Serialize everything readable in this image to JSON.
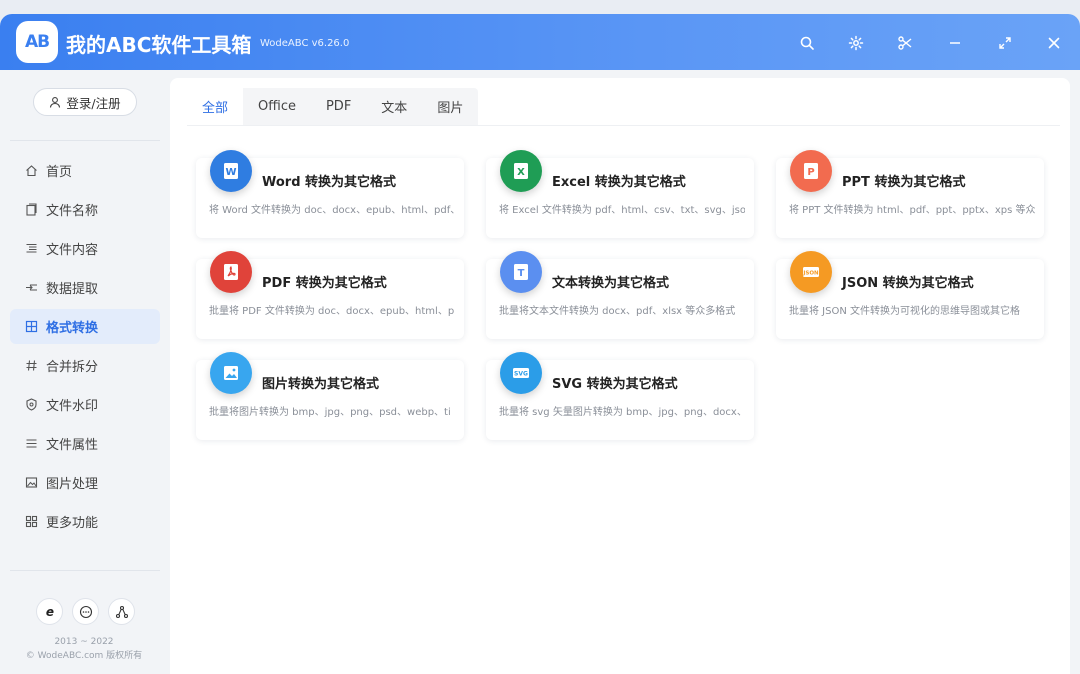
{
  "app": {
    "title": "我的ABC软件工具箱",
    "version": "WodeABC v6.26.0",
    "logo_text": "AB"
  },
  "titlebar_buttons": [
    "search-icon",
    "gear-icon",
    "scissors-icon",
    "minimize-icon",
    "maximize-icon",
    "close-icon"
  ],
  "sidebar": {
    "login_label": "登录/注册",
    "items": [
      {
        "label": "首页",
        "icon": "home-icon"
      },
      {
        "label": "文件名称",
        "icon": "file-name-icon"
      },
      {
        "label": "文件内容",
        "icon": "file-content-icon"
      },
      {
        "label": "数据提取",
        "icon": "data-extract-icon"
      },
      {
        "label": "格式转换",
        "icon": "format-convert-icon",
        "active": true
      },
      {
        "label": "合并拆分",
        "icon": "hash-icon"
      },
      {
        "label": "文件水印",
        "icon": "shield-icon"
      },
      {
        "label": "文件属性",
        "icon": "list-icon"
      },
      {
        "label": "图片处理",
        "icon": "image-icon"
      },
      {
        "label": "更多功能",
        "icon": "grid-icon"
      }
    ],
    "bottom_icons": [
      "ie-browser-icon",
      "chat-icon",
      "share-icon"
    ],
    "copyright_years": "2013 ~ 2022",
    "copyright_text": "© WodeABC.com 版权所有"
  },
  "tabs": [
    {
      "label": "全部",
      "active": true
    },
    {
      "label": "Office"
    },
    {
      "label": "PDF"
    },
    {
      "label": "文本"
    },
    {
      "label": "图片"
    }
  ],
  "cards": [
    {
      "title": "Word 转换为其它格式",
      "desc": "将 Word 文件转换为 doc、docx、epub、html、pdf、",
      "icon": "word-icon",
      "color": "#2f7de1",
      "letter": "W"
    },
    {
      "title": "Excel 转换为其它格式",
      "desc": "将 Excel 文件转换为 pdf、html、csv、txt、svg、json",
      "icon": "excel-icon",
      "color": "#1f9d55",
      "letter": "X"
    },
    {
      "title": "PPT 转换为其它格式",
      "desc": "将 PPT 文件转换为 html、pdf、ppt、pptx、xps 等众",
      "icon": "ppt-icon",
      "color": "#f26b4f",
      "letter": "P"
    },
    {
      "title": "PDF 转换为其它格式",
      "desc": "批量将 PDF 文件转换为 doc、docx、epub、html、p",
      "icon": "pdf-icon",
      "color": "#e0433a",
      "letter": "A"
    },
    {
      "title": "文本转换为其它格式",
      "desc": "批量将文本文件转换为 docx、pdf、xlsx 等众多格式",
      "icon": "text-icon",
      "color": "#5b8ff0",
      "letter": "T"
    },
    {
      "title": "JSON 转换为其它格式",
      "desc": "批量将 JSON 文件转换为可视化的思维导图或其它格",
      "icon": "json-icon",
      "color": "#f59a23",
      "letter": "J"
    },
    {
      "title": "图片转换为其它格式",
      "desc": "批量将图片转换为 bmp、jpg、png、psd、webp、ti",
      "icon": "image-file-icon",
      "color": "#38a6ef",
      "letter": "I"
    },
    {
      "title": "SVG 转换为其它格式",
      "desc": "批量将 svg 矢量图片转换为 bmp、jpg、png、docx、",
      "icon": "svg-icon",
      "color": "#2b9de8",
      "letter": "SVG"
    }
  ]
}
